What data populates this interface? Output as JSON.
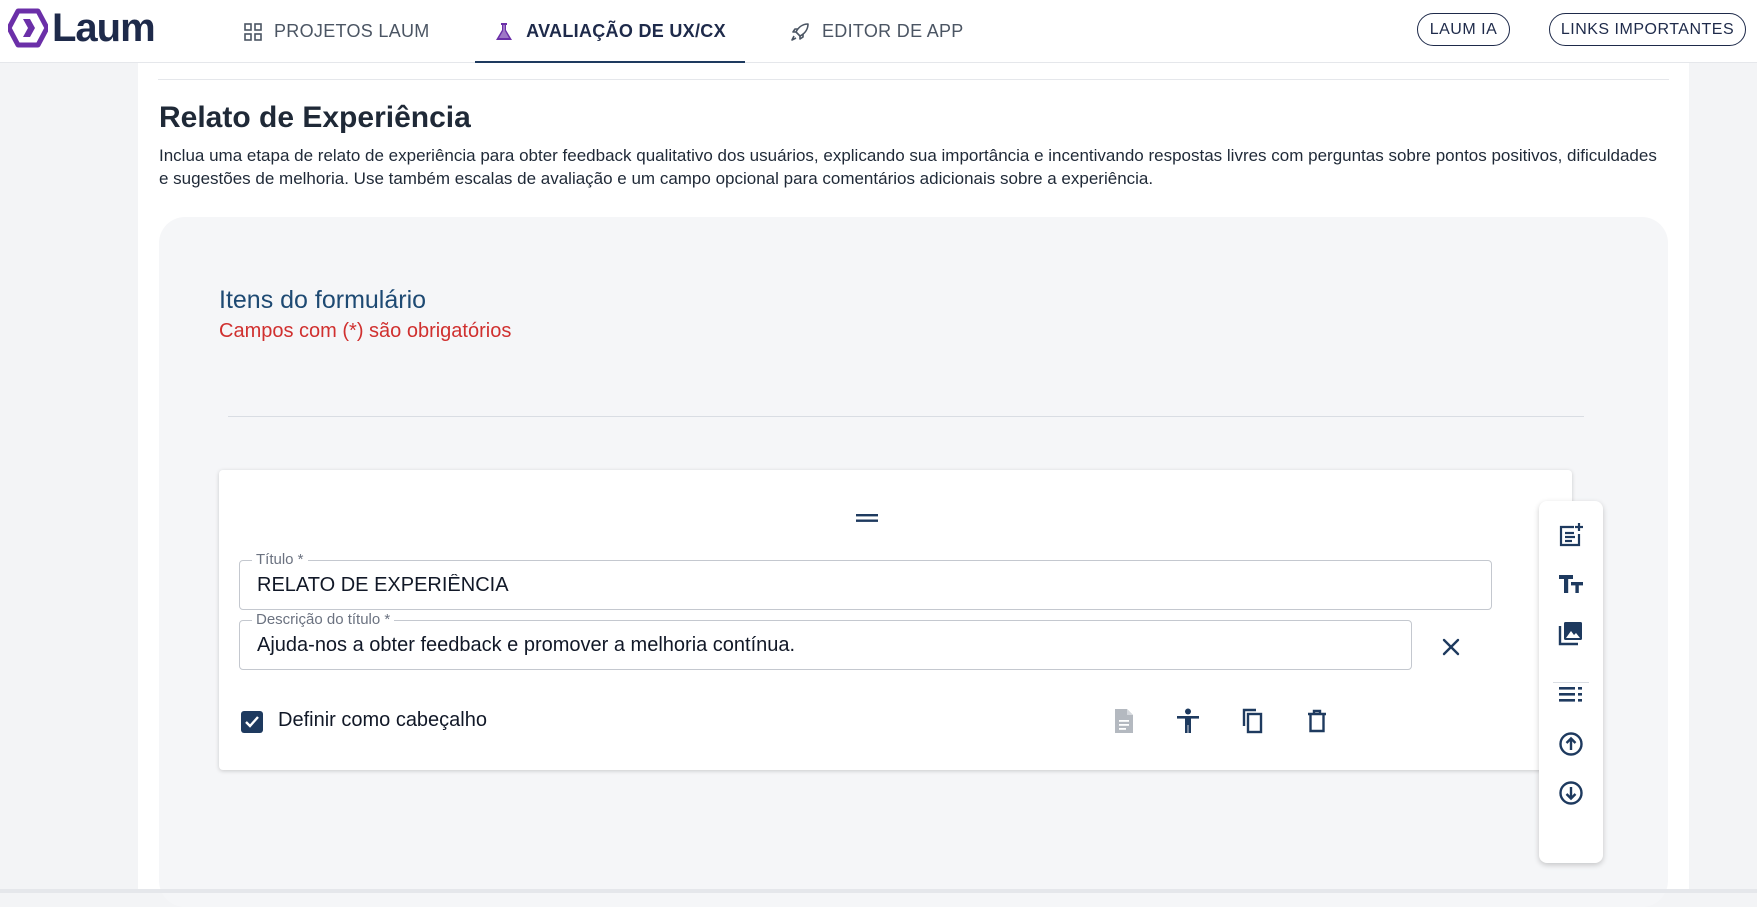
{
  "header": {
    "logo_text": "Laum",
    "tabs": [
      {
        "label": "PROJETOS LAUM",
        "icon": "grid-icon",
        "active": false
      },
      {
        "label": "AVALIAÇÃO DE UX/CX",
        "icon": "flask-icon",
        "active": true
      },
      {
        "label": "EDITOR DE APP",
        "icon": "rocket-icon",
        "active": false
      }
    ],
    "laum_ia_label": "LAUM IA",
    "links_label": "LINKS IMPORTANTES"
  },
  "section": {
    "title": "Relato de Experiência",
    "description": "Inclua uma etapa de relato de experiência para obter feedback qualitativo dos usuários, explicando sua importância e incentivando respostas livres com perguntas sobre pontos positivos, dificuldades e sugestões de melhoria. Use também escalas de avaliação e um campo opcional para comentários adicionais sobre a experiência."
  },
  "form": {
    "title": "Itens do formulário",
    "required_note": "Campos com (*) são obrigatórios",
    "card": {
      "title_label": "Título *",
      "title_value": "RELATO DE EXPERIÊNCIA",
      "desc_label": "Descrição do título *",
      "desc_value": "Ajuda-nos a obter feedback e promover a melhoria contínua.",
      "header_checkbox_label": "Definir como cabeçalho",
      "header_checked": true
    }
  },
  "toolbar": {
    "items": [
      "add-question-icon",
      "text-title-icon",
      "image-icon",
      "section-icon",
      "move-up-icon",
      "move-down-icon"
    ]
  },
  "colors": {
    "brand": "#1e2a4a",
    "accent": "#1e3a5f",
    "logo_purple": "#6b2fa8",
    "required_red": "#d0302f",
    "form_title_blue": "#1e4a73"
  }
}
